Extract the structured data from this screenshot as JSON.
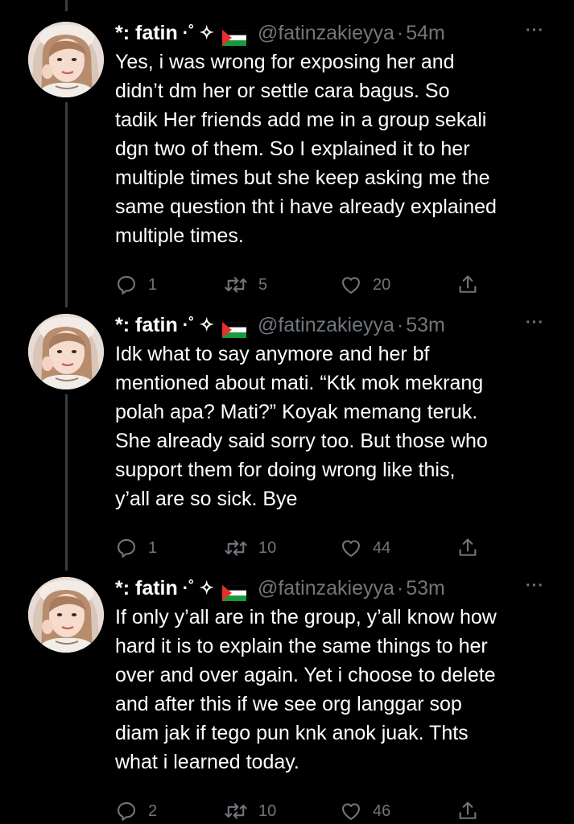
{
  "colors": {
    "background": "#000000",
    "text": "#ffffff",
    "muted": "#71767b",
    "thread_line": "#3a3d40"
  },
  "tweets": [
    {
      "name": "*: fatin",
      "decoration": "·˚ ✧",
      "handle": "@fatinzakieyya",
      "separator": "·",
      "time": "54m",
      "more": "···",
      "text_lines": [
        "Yes, i was wrong for exposing her and",
        "didn’t dm her or settle cara bagus. So",
        "tadik Her friends add me in a group sekali",
        "dgn two of them. So I explained it to her",
        "multiple times but she keep asking me the",
        "same question tht i have already explained",
        "multiple times."
      ],
      "replies": "1",
      "retweets": "5",
      "likes": "20"
    },
    {
      "name": "*: fatin",
      "decoration": "·˚ ✧",
      "handle": "@fatinzakieyya",
      "separator": "·",
      "time": "53m",
      "more": "···",
      "text_lines": [
        "Idk what to say anymore and her bf",
        "mentioned about mati. “Ktk mok mekrang",
        "polah apa? Mati?” Koyak memang teruk.",
        "She already said sorry too. But those who",
        "support them for doing wrong like this,",
        "y’all are so sick. Bye"
      ],
      "replies": "1",
      "retweets": "10",
      "likes": "44"
    },
    {
      "name": "*: fatin",
      "decoration": "·˚ ✧",
      "handle": "@fatinzakieyya",
      "separator": "·",
      "time": "53m",
      "more": "···",
      "text_lines": [
        "If only y’all are in the group, y’all know how",
        "hard it is to explain the same things to her",
        "over and over again. Yet i choose to delete",
        "and after this if we see org langgar sop",
        "diam jak if tego pun knk anok juak. Thts",
        "what i learned today."
      ],
      "replies": "2",
      "retweets": "10",
      "likes": "46"
    }
  ]
}
